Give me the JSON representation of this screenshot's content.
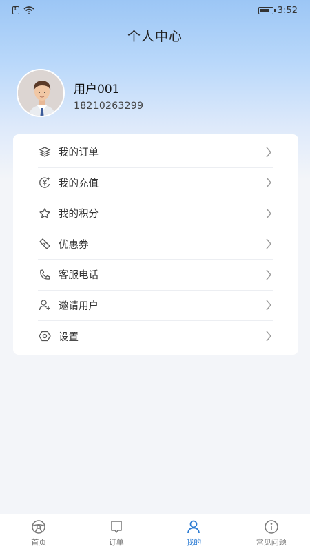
{
  "status_bar": {
    "time": "3:52"
  },
  "header": {
    "title": "个人中心"
  },
  "profile": {
    "username": "用户001",
    "phone": "18210263299"
  },
  "menu": {
    "items": [
      {
        "label": "我的订单",
        "icon": "layers-icon"
      },
      {
        "label": "我的充值",
        "icon": "yen-coin-icon"
      },
      {
        "label": "我的积分",
        "icon": "star-icon"
      },
      {
        "label": "优惠券",
        "icon": "ticket-icon"
      },
      {
        "label": "客服电话",
        "icon": "phone-icon"
      },
      {
        "label": "邀请用户",
        "icon": "user-plus-icon"
      },
      {
        "label": "设置",
        "icon": "gear-icon"
      }
    ]
  },
  "tabbar": {
    "tabs": [
      {
        "label": "首页",
        "icon": "steering-wheel-icon",
        "active": false
      },
      {
        "label": "订单",
        "icon": "order-icon",
        "active": false
      },
      {
        "label": "我的",
        "icon": "user-icon",
        "active": true
      },
      {
        "label": "常见问题",
        "icon": "info-icon",
        "active": false
      }
    ]
  },
  "colors": {
    "accent": "#2b7bd3",
    "header_gradient_top": "#9cc6f5",
    "background": "#f3f5f9"
  }
}
